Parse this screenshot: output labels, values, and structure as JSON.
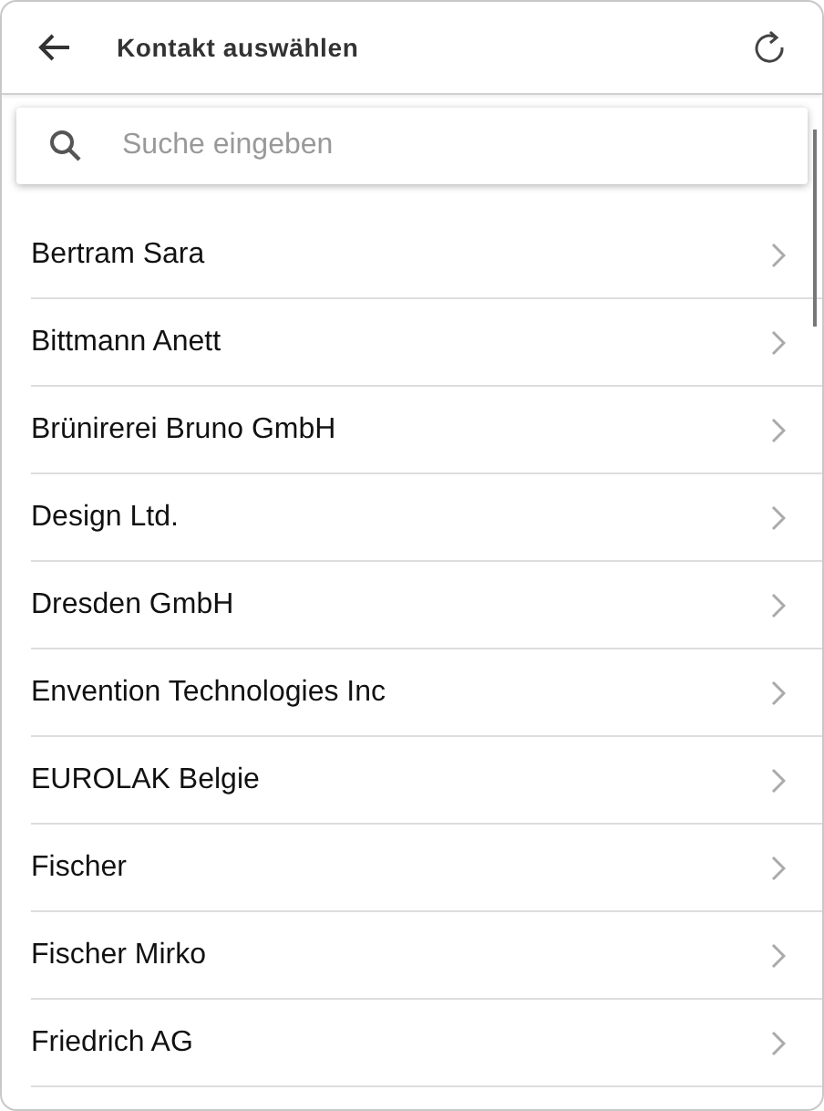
{
  "header": {
    "title": "Kontakt auswählen"
  },
  "search": {
    "placeholder": "Suche eingeben"
  },
  "contacts": [
    {
      "name": "Bertram Sara"
    },
    {
      "name": "Bittmann Anett"
    },
    {
      "name": "Brünirerei Bruno GmbH"
    },
    {
      "name": "Design Ltd."
    },
    {
      "name": "Dresden GmbH"
    },
    {
      "name": "Envention Technologies Inc"
    },
    {
      "name": "EUROLAK Belgie"
    },
    {
      "name": "Fischer"
    },
    {
      "name": "Fischer Mirko"
    },
    {
      "name": "Friedrich AG"
    }
  ]
}
